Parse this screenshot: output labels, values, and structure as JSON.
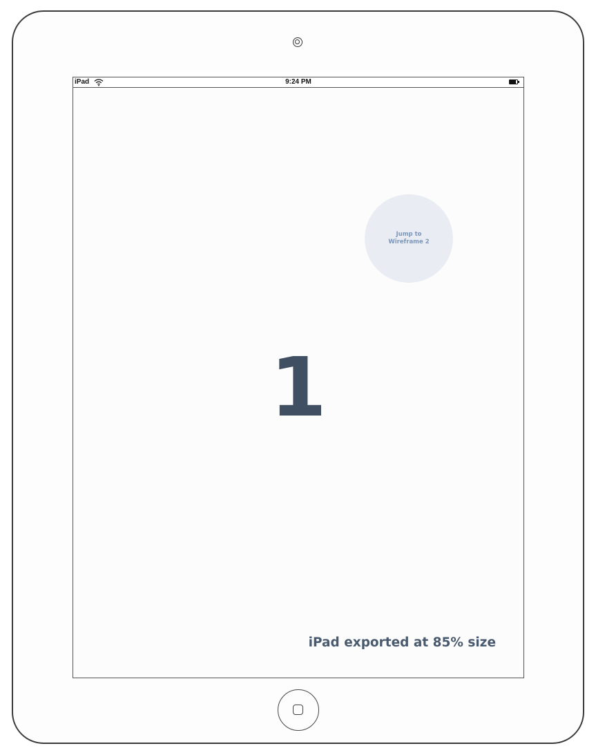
{
  "status_bar": {
    "carrier": "iPad",
    "time": "9:24 PM",
    "wifi_icon": "wifi-icon",
    "battery_icon": "battery-icon"
  },
  "screen": {
    "jump_button": {
      "line1": "Jump to",
      "line2": "Wireframe 2"
    },
    "page_number": "1",
    "export_note": "iPad exported at 85% size"
  },
  "device": {
    "camera_icon": "camera-icon",
    "home_button_icon": "home-button-icon"
  },
  "colors": {
    "number": "#404f61",
    "jump_button_bg": "#e9edf3",
    "jump_button_text": "#7c97bb",
    "note": "#495a6e"
  }
}
